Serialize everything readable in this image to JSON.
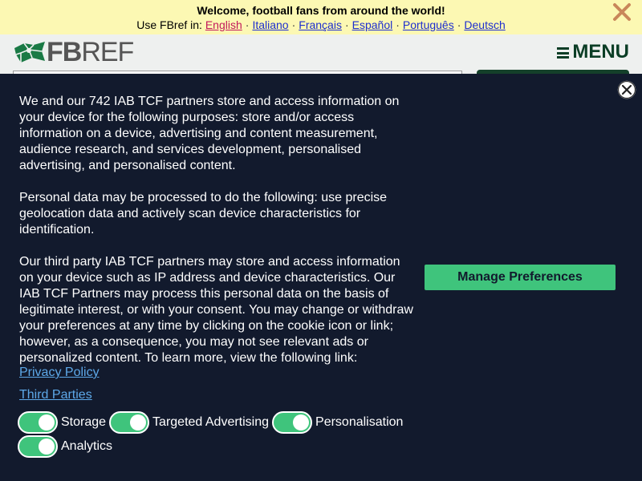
{
  "banner": {
    "title": "Welcome, football fans from around the world!",
    "prefix": "Use FBref in:",
    "languages": [
      "English",
      "Italiano",
      "Français",
      "Español",
      "Português",
      "Deutsch"
    ],
    "close_icon": "close-x-icon",
    "colors": {
      "background": "#fcf8b3",
      "link": "#1d2ecf",
      "current": "#c2185b",
      "close": "#c9875a"
    }
  },
  "header": {
    "logo_text_bold": "FB",
    "logo_text_regular": "REF",
    "menu_label": "MENU",
    "menu_icon": "hamburger-icon",
    "colors": {
      "menu": "#0b3d25",
      "logo_green": "#1a7a45"
    }
  },
  "consent": {
    "paragraphs": [
      "We and our 742 IAB TCF partners store and access information on your device for the following purposes: store and/or access information on a device, advertising and content measurement, audience research, and services development, personalised advertising, and personalised content.",
      "Personal data may be processed to do the following: use precise geolocation data and actively scan device characteristics for identification.",
      "Our third party IAB TCF partners may store and access information on your device such as IP address and device characteristics. Our IAB TCF Partners may process this personal data on the basis of legitimate interest, or with your consent. You may change or withdraw your preferences at any time by clicking on the cookie icon or link; however, as a consequence, you may not see relevant ads or personalized content. To learn more, view the following link:"
    ],
    "privacy_link": "Privacy Policy",
    "third_parties_link": "Third Parties",
    "toggles": [
      {
        "label": "Storage",
        "on": true
      },
      {
        "label": "Targeted Advertising",
        "on": true
      },
      {
        "label": "Personalisation",
        "on": true
      },
      {
        "label": "Analytics",
        "on": true
      }
    ],
    "manage_button": "Manage Preferences",
    "close_icon": "close-circle-icon",
    "colors": {
      "background": "#121a2d",
      "accent": "#3fc47c",
      "link": "#5da8e8"
    }
  }
}
